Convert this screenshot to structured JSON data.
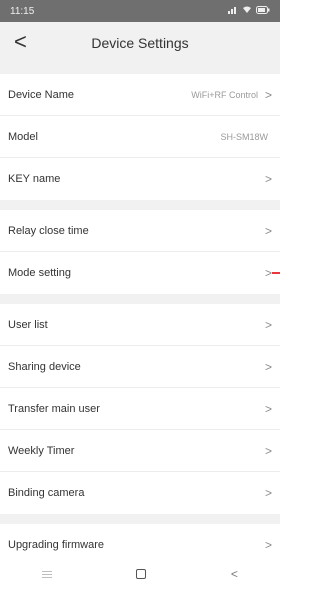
{
  "status": {
    "time": "11:15",
    "icons": [
      "signal-icon",
      "wifi-icon",
      "battery-icon"
    ]
  },
  "header": {
    "back_glyph": "<",
    "title": "Device Settings"
  },
  "groups": [
    {
      "rows": [
        {
          "label": "Device Name",
          "value": "WiFi+RF Control"
        },
        {
          "label": "Model",
          "value": "SH-SM18W"
        },
        {
          "label": "KEY name",
          "value": ""
        }
      ]
    },
    {
      "rows": [
        {
          "label": "Relay close time",
          "value": ""
        },
        {
          "label": "Mode setting",
          "value": ""
        }
      ]
    },
    {
      "rows": [
        {
          "label": "User list",
          "value": ""
        },
        {
          "label": "Sharing device",
          "value": ""
        },
        {
          "label": "Transfer main user",
          "value": ""
        },
        {
          "label": "Weekly Timer",
          "value": ""
        },
        {
          "label": "Binding camera",
          "value": ""
        }
      ]
    },
    {
      "rows": [
        {
          "label": "Upgrading firmware",
          "value": ""
        }
      ]
    }
  ],
  "chevron": ">",
  "colors": {
    "accent_mark": "#e8363a",
    "background": "#f1f1f1",
    "status_bar": "#6f6f6f"
  }
}
